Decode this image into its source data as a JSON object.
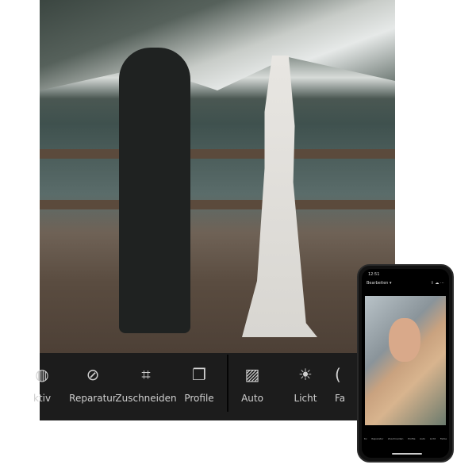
{
  "toolbar": {
    "items": [
      {
        "label": "ktiv",
        "icon": "selective-icon"
      },
      {
        "label": "Reparatur",
        "icon": "bandage-icon"
      },
      {
        "label": "Zuschneiden",
        "icon": "crop-icon"
      },
      {
        "label": "Profile",
        "icon": "profiles-icon"
      },
      {
        "label": "Auto",
        "icon": "auto-icon"
      },
      {
        "label": "Licht",
        "icon": "light-icon"
      },
      {
        "label": "Fa",
        "icon": "color-icon"
      }
    ]
  },
  "phone": {
    "time": "12:51",
    "title": "Bearbeiten ▾",
    "toolbar": [
      "tiv",
      "Reparatur",
      "Zuschneiden",
      "Profile",
      "Auto",
      "Licht",
      "Farbe"
    ]
  }
}
